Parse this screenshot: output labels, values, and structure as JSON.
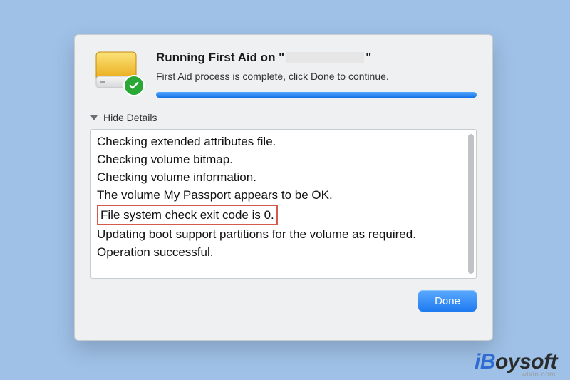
{
  "header": {
    "title_prefix": "Running First Aid on \"",
    "title_suffix": "\"",
    "subtitle": "First Aid process is complete, click Done to continue."
  },
  "progress": {
    "percent": 100
  },
  "details": {
    "toggle_label": "Hide Details",
    "lines": [
      "Checking extended attributes file.",
      "Checking volume bitmap.",
      "Checking volume information.",
      "The volume My Passport appears to be OK.",
      "File system check exit code is 0.",
      "Updating boot support partitions for the volume as required.",
      "Operation successful."
    ],
    "highlight_index": 4
  },
  "footer": {
    "done_label": "Done"
  },
  "watermark": {
    "brand_i": "i",
    "brand_b": "B",
    "brand_rest": "oysoft",
    "sub": "wixin.com"
  }
}
